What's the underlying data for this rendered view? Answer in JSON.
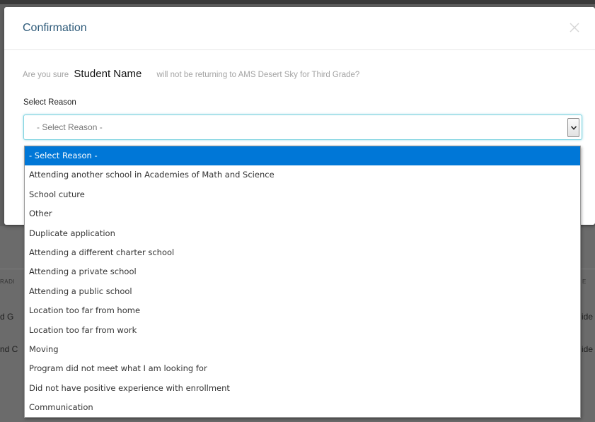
{
  "modal": {
    "title": "Confirmation",
    "question_prefix": "Are you sure",
    "student_name": "Student Name",
    "question_suffix": "will not be returning to AMS Desert Sky for Third Grade?",
    "reason_label": "Select Reason"
  },
  "select": {
    "current_value": "- Select Reason -",
    "options": [
      "- Select Reason -",
      "Attending another school in Academies of Math and Science",
      "School cuture",
      "Other",
      "Duplicate application",
      "Attending a different charter school",
      "Attending a private school",
      "Attending a public school",
      "Location too far from home",
      "Location too far from work",
      "Moving",
      "Program did not meet what I am looking for",
      "Did not have positive experience with enrollment",
      "Communication"
    ],
    "highlighted_index": 0
  },
  "background": {
    "left_header_fragment": "RADI",
    "right_header_fragment": "E",
    "row1_left": "d G",
    "row1_right": "ide",
    "row2_left": "nd C",
    "row2_right": "ide"
  },
  "colors": {
    "title": "#2f5b7a",
    "highlight": "#0077d7",
    "focus_border": "#7fd3e0",
    "overlay": "#5f5f5f"
  }
}
